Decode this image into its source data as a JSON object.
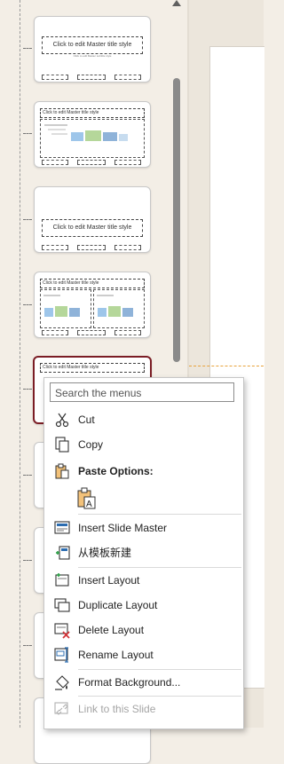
{
  "thumbnails": [
    {
      "title": "Click to edit Master title style",
      "subtitle": "Click to edit Master subtitle style",
      "kind": "title"
    },
    {
      "title": "Click to edit Master title style",
      "kind": "content"
    },
    {
      "title": "Click to edit Master title style",
      "kind": "section"
    },
    {
      "title": "Click to edit Master title style",
      "kind": "two-content"
    },
    {
      "title": "Click to edit Master title style",
      "kind": "comparison",
      "selected": true
    }
  ],
  "context_menu": {
    "search_placeholder": "Search the menus",
    "items": [
      {
        "label": "Cut",
        "icon": "scissors-icon",
        "enabled": true
      },
      {
        "label": "Copy",
        "icon": "copy-icon",
        "enabled": true
      },
      {
        "label": "Paste Options:",
        "icon": "clipboard-icon",
        "enabled": true,
        "bold": true
      },
      {
        "label": "Insert Slide Master",
        "icon": "insert-slide-master-icon",
        "enabled": true
      },
      {
        "label": "从模板新建",
        "icon": "new-from-template-icon",
        "enabled": true
      },
      {
        "label": "Insert Layout",
        "icon": "insert-layout-icon",
        "enabled": true
      },
      {
        "label": "Duplicate Layout",
        "icon": "duplicate-layout-icon",
        "enabled": true
      },
      {
        "label": "Delete Layout",
        "icon": "delete-layout-icon",
        "enabled": true
      },
      {
        "label": "Rename Layout",
        "icon": "rename-layout-icon",
        "enabled": true
      },
      {
        "label": "Format Background...",
        "icon": "format-background-icon",
        "enabled": true
      },
      {
        "label": "Link to this Slide",
        "icon": "link-slide-icon",
        "enabled": false
      }
    ],
    "paste_option_icon": "paste-keep-text-icon"
  },
  "colors": {
    "selected_border": "#7b1d25",
    "guide": "#e8a23b",
    "delete_mark": "#d13438",
    "accent_icon": "#2b6cb0"
  }
}
